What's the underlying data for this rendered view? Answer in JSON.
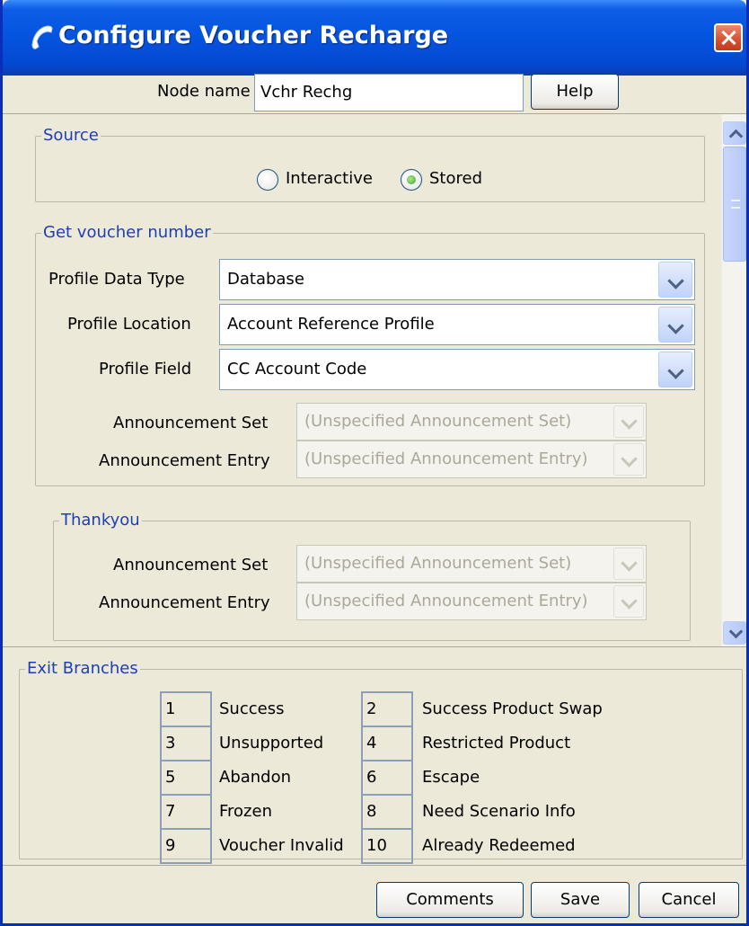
{
  "window": {
    "title": "Configure Voucher Recharge",
    "icon": "phone-handset-icon",
    "close_icon": "close-icon"
  },
  "header": {
    "node_name_label": "Node name",
    "node_name_value": "Vchr Rechg",
    "help_label": "Help"
  },
  "source": {
    "title": "Source",
    "options": [
      {
        "label": "Interactive",
        "checked": false
      },
      {
        "label": "Stored",
        "checked": true
      }
    ]
  },
  "get_voucher": {
    "title": "Get voucher number",
    "profile_data_type_label": "Profile Data Type",
    "profile_data_type_value": "Database",
    "profile_location_label": "Profile Location",
    "profile_location_value": "Account Reference Profile",
    "profile_field_label": "Profile Field",
    "profile_field_value": "CC Account Code",
    "announcement_set_label": "Announcement Set",
    "announcement_set_value": "(Unspecified Announcement Set)",
    "announcement_entry_label": "Announcement Entry",
    "announcement_entry_value": "(Unspecified Announcement Entry)"
  },
  "thankyou": {
    "title": "Thankyou",
    "announcement_set_label": "Announcement Set",
    "announcement_set_value": "(Unspecified Announcement Set)",
    "announcement_entry_label": "Announcement Entry",
    "announcement_entry_value": "(Unspecified Announcement Entry)"
  },
  "exit_branches": {
    "title": "Exit Branches",
    "rows": [
      [
        {
          "num": "1",
          "name": "Success"
        },
        {
          "num": "2",
          "name": "Success Product Swap"
        }
      ],
      [
        {
          "num": "3",
          "name": "Unsupported"
        },
        {
          "num": "4",
          "name": "Restricted Product"
        }
      ],
      [
        {
          "num": "5",
          "name": "Abandon"
        },
        {
          "num": "6",
          "name": "Escape"
        }
      ],
      [
        {
          "num": "7",
          "name": "Frozen"
        },
        {
          "num": "8",
          "name": "Need Scenario Info"
        }
      ],
      [
        {
          "num": "9",
          "name": "Voucher Invalid"
        },
        {
          "num": "10",
          "name": "Already Redeemed"
        }
      ]
    ]
  },
  "footer": {
    "comments_label": "Comments",
    "save_label": "Save",
    "cancel_label": "Cancel"
  }
}
